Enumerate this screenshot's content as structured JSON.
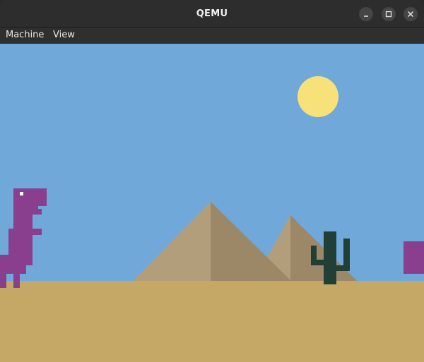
{
  "window": {
    "title": "QEMU",
    "controls": {
      "minimize": "minimize-icon",
      "maximize": "maximize-icon",
      "close": "close-icon"
    }
  },
  "menubar": {
    "items": [
      {
        "label": "Machine"
      },
      {
        "label": "View"
      }
    ]
  },
  "game": {
    "colors": {
      "sky": "#6fa8d9",
      "sand": "#c5a766",
      "sun": "#f7e27a",
      "dino": "#8a3e8e",
      "pyramid_light": "#b39e7c",
      "pyramid_shade": "#9c8766",
      "cactus": "#223f36"
    },
    "sprites": [
      "dinosaur",
      "sun",
      "pyramid",
      "pyramid",
      "cactus",
      "obstacle"
    ]
  }
}
